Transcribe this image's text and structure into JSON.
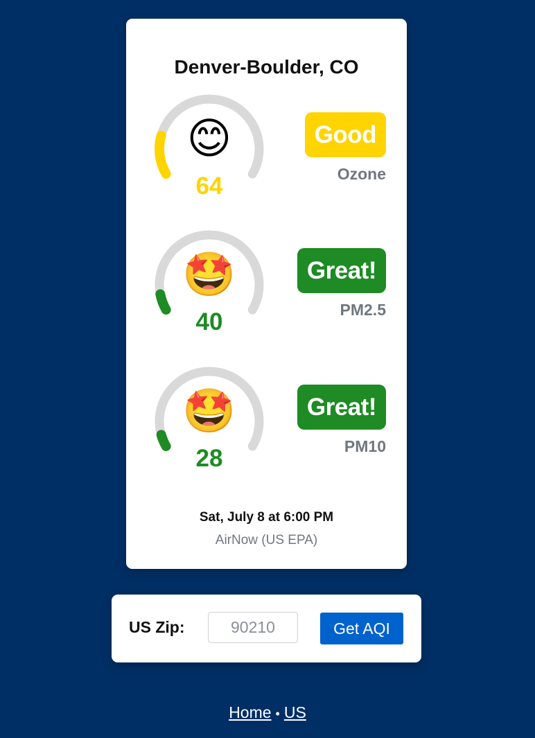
{
  "card": {
    "title": "Denver-Boulder, CO",
    "readings": [
      {
        "emoji": "😊",
        "value": "64",
        "rating": "Good",
        "pollutant": "Ozone",
        "color": "#ffd400",
        "gauge_fraction": 0.19
      },
      {
        "emoji": "🤩",
        "value": "40",
        "rating": "Great!",
        "pollutant": "PM2.5",
        "color": "#1e8b24",
        "gauge_fraction": 0.08
      },
      {
        "emoji": "🤩",
        "value": "28",
        "rating": "Great!",
        "pollutant": "PM10",
        "color": "#1e8b24",
        "gauge_fraction": 0.06
      }
    ],
    "updated": "Sat, July 8 at 6:00 PM",
    "source": "AirNow (US EPA)"
  },
  "zip_form": {
    "label": "US Zip:",
    "placeholder": "90210",
    "value": "",
    "button_label": "Get AQI"
  },
  "footer": {
    "links": [
      "Home",
      "US"
    ],
    "separator": "•"
  },
  "colors": {
    "background": "#002f65",
    "track": "#d9d9d9",
    "button": "#0062cc",
    "muted_text": "#6f7780"
  }
}
